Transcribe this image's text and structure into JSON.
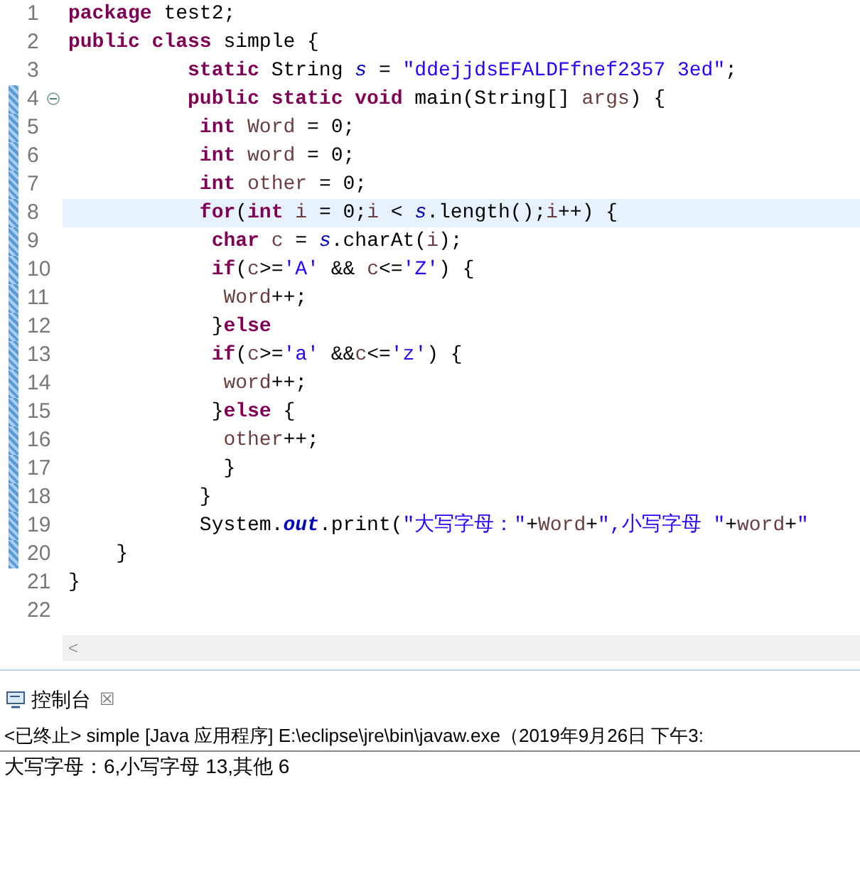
{
  "editor": {
    "lines": [
      {
        "number": "1",
        "changed": false,
        "current": false,
        "foldable": false,
        "tokens": [
          {
            "kind": "keyword",
            "text": "package"
          },
          {
            "kind": "plain",
            "text": " test2;"
          }
        ]
      },
      {
        "number": "2",
        "changed": false,
        "current": false,
        "foldable": false,
        "tokens": [
          {
            "kind": "keyword",
            "text": "public class"
          },
          {
            "kind": "plain",
            "text": " simple {"
          }
        ]
      },
      {
        "number": "3",
        "changed": false,
        "current": false,
        "foldable": false,
        "tokens": [
          {
            "kind": "keyword",
            "text": "          static"
          },
          {
            "kind": "plain",
            "text": " String "
          },
          {
            "kind": "field",
            "text": "s"
          },
          {
            "kind": "plain",
            "text": " = "
          },
          {
            "kind": "string",
            "text": "\"ddejjdsEFALDFfnef2357 3ed\""
          },
          {
            "kind": "plain",
            "text": ";"
          }
        ]
      },
      {
        "number": "4",
        "changed": true,
        "current": false,
        "foldable": true,
        "tokens": [
          {
            "kind": "keyword",
            "text": "          public static void"
          },
          {
            "kind": "plain",
            "text": " main(String[] "
          },
          {
            "kind": "variable",
            "text": "args"
          },
          {
            "kind": "plain",
            "text": ") {"
          }
        ]
      },
      {
        "number": "5",
        "changed": true,
        "current": false,
        "foldable": false,
        "tokens": [
          {
            "kind": "keyword",
            "text": "           int "
          },
          {
            "kind": "variable",
            "text": "Word"
          },
          {
            "kind": "plain",
            "text": " = 0;"
          }
        ]
      },
      {
        "number": "6",
        "changed": true,
        "current": false,
        "foldable": false,
        "tokens": [
          {
            "kind": "keyword",
            "text": "           int "
          },
          {
            "kind": "variable",
            "text": "word"
          },
          {
            "kind": "plain",
            "text": " = 0;"
          }
        ]
      },
      {
        "number": "7",
        "changed": true,
        "current": false,
        "foldable": false,
        "tokens": [
          {
            "kind": "keyword",
            "text": "           int "
          },
          {
            "kind": "variable",
            "text": "other"
          },
          {
            "kind": "plain",
            "text": " = 0;"
          }
        ]
      },
      {
        "number": "8",
        "changed": true,
        "current": true,
        "foldable": false,
        "tokens": [
          {
            "kind": "keyword",
            "text": "           for"
          },
          {
            "kind": "plain",
            "text": "("
          },
          {
            "kind": "keyword",
            "text": "int "
          },
          {
            "kind": "variable",
            "text": "i"
          },
          {
            "kind": "plain",
            "text": " = 0;"
          },
          {
            "kind": "variable",
            "text": "i"
          },
          {
            "kind": "plain",
            "text": " < "
          },
          {
            "kind": "field",
            "text": "s"
          },
          {
            "kind": "plain",
            "text": ".length();"
          },
          {
            "kind": "variable",
            "text": "i"
          },
          {
            "kind": "plain",
            "text": "++) {"
          }
        ]
      },
      {
        "number": "9",
        "changed": true,
        "current": false,
        "foldable": false,
        "tokens": [
          {
            "kind": "keyword",
            "text": "            char "
          },
          {
            "kind": "variable",
            "text": "c"
          },
          {
            "kind": "plain",
            "text": " = "
          },
          {
            "kind": "field",
            "text": "s"
          },
          {
            "kind": "plain",
            "text": ".charAt("
          },
          {
            "kind": "variable",
            "text": "i"
          },
          {
            "kind": "plain",
            "text": ");"
          }
        ]
      },
      {
        "number": "10",
        "changed": true,
        "current": false,
        "foldable": false,
        "tokens": [
          {
            "kind": "keyword",
            "text": "            if"
          },
          {
            "kind": "plain",
            "text": "("
          },
          {
            "kind": "variable",
            "text": "c"
          },
          {
            "kind": "plain",
            "text": ">="
          },
          {
            "kind": "string",
            "text": "'A'"
          },
          {
            "kind": "plain",
            "text": " && "
          },
          {
            "kind": "variable",
            "text": "c"
          },
          {
            "kind": "plain",
            "text": "<="
          },
          {
            "kind": "string",
            "text": "'Z'"
          },
          {
            "kind": "plain",
            "text": ") {"
          }
        ]
      },
      {
        "number": "11",
        "changed": true,
        "current": false,
        "foldable": false,
        "tokens": [
          {
            "kind": "variable",
            "text": "             Word"
          },
          {
            "kind": "plain",
            "text": "++;"
          }
        ]
      },
      {
        "number": "12",
        "changed": true,
        "current": false,
        "foldable": false,
        "tokens": [
          {
            "kind": "plain",
            "text": "            }"
          },
          {
            "kind": "keyword",
            "text": "else"
          }
        ]
      },
      {
        "number": "13",
        "changed": true,
        "current": false,
        "foldable": false,
        "tokens": [
          {
            "kind": "keyword",
            "text": "            if"
          },
          {
            "kind": "plain",
            "text": "("
          },
          {
            "kind": "variable",
            "text": "c"
          },
          {
            "kind": "plain",
            "text": ">="
          },
          {
            "kind": "string",
            "text": "'a'"
          },
          {
            "kind": "plain",
            "text": " &&"
          },
          {
            "kind": "variable",
            "text": "c"
          },
          {
            "kind": "plain",
            "text": "<="
          },
          {
            "kind": "string",
            "text": "'z'"
          },
          {
            "kind": "plain",
            "text": ") {"
          }
        ]
      },
      {
        "number": "14",
        "changed": true,
        "current": false,
        "foldable": false,
        "tokens": [
          {
            "kind": "variable",
            "text": "             word"
          },
          {
            "kind": "plain",
            "text": "++;"
          }
        ]
      },
      {
        "number": "15",
        "changed": true,
        "current": false,
        "foldable": false,
        "tokens": [
          {
            "kind": "plain",
            "text": "            }"
          },
          {
            "kind": "keyword",
            "text": "else"
          },
          {
            "kind": "plain",
            "text": " {"
          }
        ]
      },
      {
        "number": "16",
        "changed": true,
        "current": false,
        "foldable": false,
        "tokens": [
          {
            "kind": "variable",
            "text": "             other"
          },
          {
            "kind": "plain",
            "text": "++;"
          }
        ]
      },
      {
        "number": "17",
        "changed": true,
        "current": false,
        "foldable": false,
        "tokens": [
          {
            "kind": "plain",
            "text": "             }"
          }
        ]
      },
      {
        "number": "18",
        "changed": true,
        "current": false,
        "foldable": false,
        "tokens": [
          {
            "kind": "plain",
            "text": "           }"
          }
        ]
      },
      {
        "number": "19",
        "changed": true,
        "current": false,
        "foldable": false,
        "tokens": [
          {
            "kind": "plain",
            "text": "           System."
          },
          {
            "kind": "static_bold",
            "text": "out"
          },
          {
            "kind": "plain",
            "text": ".print("
          },
          {
            "kind": "string",
            "text": "\"大写字母：\""
          },
          {
            "kind": "plain",
            "text": "+"
          },
          {
            "kind": "variable",
            "text": "Word"
          },
          {
            "kind": "plain",
            "text": "+"
          },
          {
            "kind": "string",
            "text": "\",小写字母 \""
          },
          {
            "kind": "plain",
            "text": "+"
          },
          {
            "kind": "variable",
            "text": "word"
          },
          {
            "kind": "plain",
            "text": "+"
          },
          {
            "kind": "string",
            "text": "\""
          }
        ]
      },
      {
        "number": "20",
        "changed": true,
        "current": false,
        "foldable": false,
        "tokens": [
          {
            "kind": "plain",
            "text": "    }"
          }
        ]
      },
      {
        "number": "21",
        "changed": false,
        "current": false,
        "foldable": false,
        "tokens": [
          {
            "kind": "plain",
            "text": "}"
          }
        ]
      },
      {
        "number": "22",
        "changed": false,
        "current": false,
        "foldable": false
      }
    ],
    "scroll_left": "<"
  },
  "console": {
    "tab": {
      "label": "控制台",
      "close": "☒"
    },
    "header": "<已终止> simple [Java 应用程序] E:\\eclipse\\jre\\bin\\javaw.exe（2019年9月26日 下午3:",
    "output": [
      "大写字母：6,小写字母 13,其他 6"
    ]
  }
}
